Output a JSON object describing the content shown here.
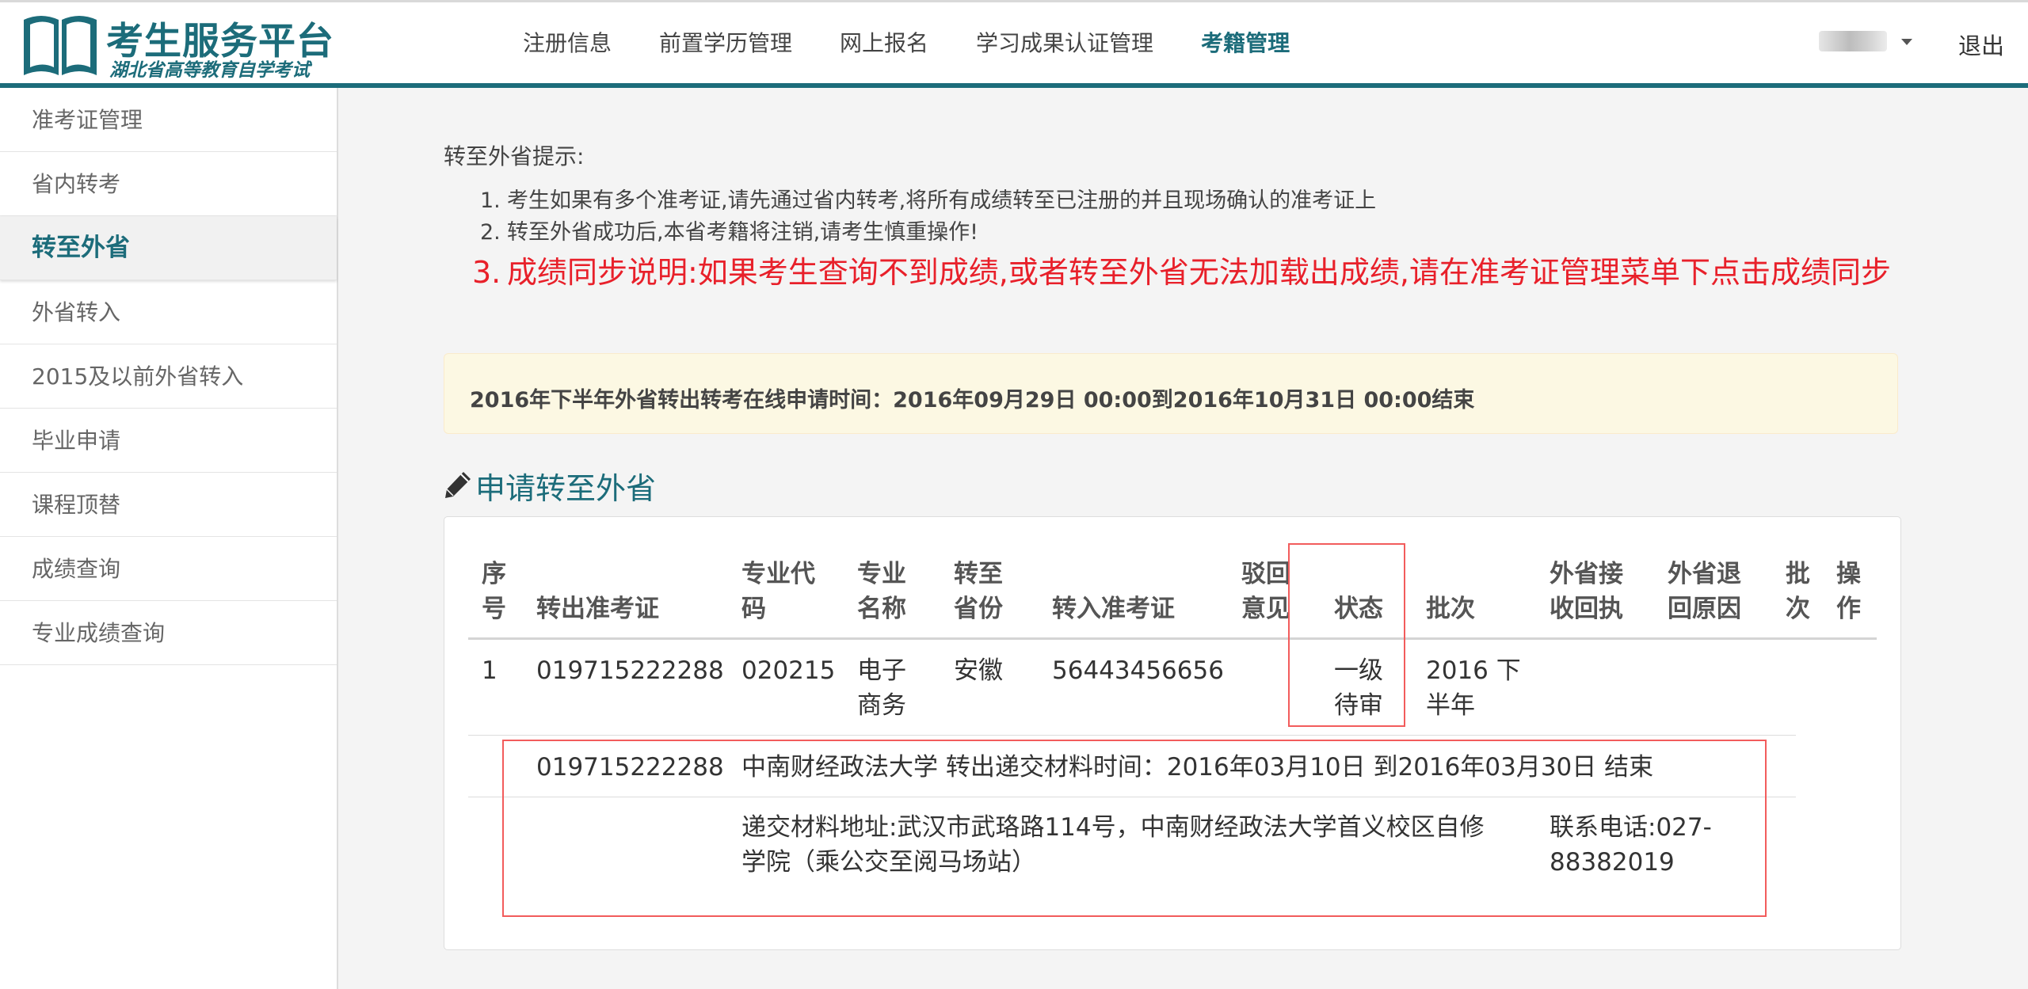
{
  "header": {
    "logo_title": "考生服务平台",
    "logo_subtitle": "湖北省高等教育自学考试",
    "nav": [
      "注册信息",
      "前置学历管理",
      "网上报名",
      "学习成果认证管理",
      "考籍管理"
    ],
    "active_nav": "考籍管理",
    "logout": "退出"
  },
  "sidebar": {
    "items": [
      "准考证管理",
      "省内转考",
      "转至外省",
      "外省转入",
      "2015及以前外省转入",
      "毕业申请",
      "课程顶替",
      "成绩查询",
      "专业成绩查询"
    ],
    "active": "转至外省"
  },
  "tips": {
    "title": "转至外省提示:",
    "items": [
      {
        "num": "1.",
        "text": "考生如果有多个准考证,请先通过省内转考,将所有成绩转至已注册的并且现场确认的准考证上"
      },
      {
        "num": "2.",
        "text": "转至外省成功后,本省考籍将注销,请考生慎重操作!"
      }
    ],
    "highlight": {
      "num": "3.",
      "text": "成绩同步说明:如果考生查询不到成绩,或者转至外省无法加载出成绩,请在准考证管理菜单下点击成绩同步"
    }
  },
  "notice": "2016年下半年外省转出转考在线申请时间：2016年09月29日 00:00到2016年10月31日 00:00结束",
  "section_title": "申请转至外省",
  "table": {
    "headers": {
      "seq": [
        "序",
        "号"
      ],
      "out_ticket": "转出准考证",
      "major_code": [
        "专业代",
        "码"
      ],
      "major_name": [
        "专业",
        "名称"
      ],
      "to_province": [
        "转至",
        "省份"
      ],
      "in_ticket": "转入准考证",
      "reject": [
        "驳回",
        "意见"
      ],
      "status": "状态",
      "batch": "批次",
      "receipt": [
        "外省接",
        "收回执"
      ],
      "return_reason": [
        "外省退",
        "回原因"
      ],
      "batch2": [
        "批",
        "次"
      ],
      "action": [
        "操",
        "作"
      ]
    },
    "row": {
      "seq": "1",
      "out_ticket": "019715222288",
      "major_code": "020215",
      "major_name": [
        "电子",
        "商务"
      ],
      "to_province": "安徽",
      "in_ticket": "56443456656",
      "status": [
        "一级",
        "待审"
      ],
      "batch": [
        "2016 下",
        "半年"
      ]
    },
    "detail": {
      "ticket": "019715222288",
      "time_info": "中南财经政法大学 转出递交材料时间：2016年03月10日 到2016年03月30日 结束",
      "address": [
        "递交材料地址:武汉市武珞路114号，中南财经政法大学首义校区自修",
        "学院（乘公交至阅马场站）"
      ],
      "phone": [
        "联系电话:027-",
        "88382019"
      ]
    }
  }
}
